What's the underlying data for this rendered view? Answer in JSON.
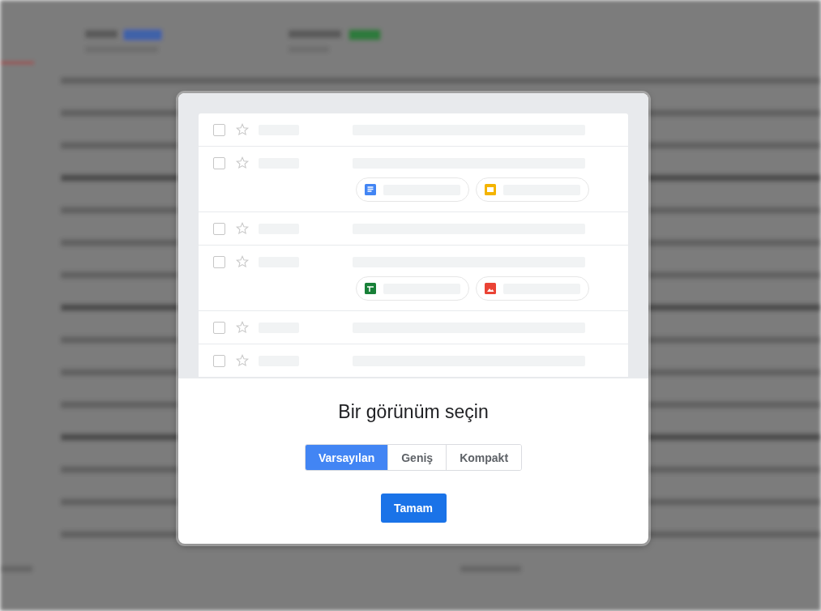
{
  "preview": {
    "rows": [
      {
        "kind": "plain",
        "checked": false,
        "starred": false
      },
      {
        "kind": "attachments",
        "checked": false,
        "starred": false,
        "attachments": [
          {
            "kind": "document"
          },
          {
            "kind": "slides"
          }
        ]
      },
      {
        "kind": "plain",
        "checked": false,
        "starred": false
      },
      {
        "kind": "attachments",
        "checked": false,
        "starred": false,
        "attachments": [
          {
            "kind": "spreadsheet"
          },
          {
            "kind": "image"
          }
        ]
      },
      {
        "kind": "plain",
        "checked": false,
        "starred": false
      },
      {
        "kind": "plain",
        "checked": false,
        "starred": false
      }
    ]
  },
  "dialog": {
    "title": "Bir görünüm seçin",
    "view_options": [
      {
        "label": "Varsayılan",
        "selected": true
      },
      {
        "label": "Geniş",
        "selected": false
      },
      {
        "label": "Kompakt",
        "selected": false
      }
    ],
    "confirm_button": "Tamam"
  }
}
